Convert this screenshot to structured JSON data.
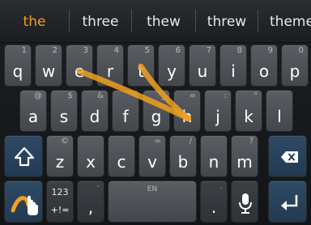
{
  "suggestions": [
    "the",
    "three",
    "thew",
    "threw",
    "theme"
  ],
  "row1": [
    {
      "label": "q",
      "hint": "1"
    },
    {
      "label": "w",
      "hint": "2"
    },
    {
      "label": "e",
      "hint": "3"
    },
    {
      "label": "r",
      "hint": "4"
    },
    {
      "label": "t",
      "hint": "5"
    },
    {
      "label": "y",
      "hint": "6"
    },
    {
      "label": "u",
      "hint": "7"
    },
    {
      "label": "i",
      "hint": "8"
    },
    {
      "label": "o",
      "hint": "9"
    },
    {
      "label": "p",
      "hint": "0"
    }
  ],
  "row2": [
    {
      "label": "a",
      "hint": "@"
    },
    {
      "label": "s",
      "hint": "$"
    },
    {
      "label": "d",
      "hint": "&"
    },
    {
      "label": "f",
      "hint": "-"
    },
    {
      "label": "g",
      "hint": "_"
    },
    {
      "label": "h",
      "hint": "="
    },
    {
      "label": "j",
      "hint": ":"
    },
    {
      "label": "k",
      "hint": "\""
    },
    {
      "label": "l",
      "hint": ""
    }
  ],
  "row3": [
    {
      "label": "z",
      "hint": "©"
    },
    {
      "label": "x",
      "hint": ""
    },
    {
      "label": "c",
      "hint": ""
    },
    {
      "label": "v",
      "hint": "="
    },
    {
      "label": "b",
      "hint": "/"
    },
    {
      "label": "n",
      "hint": ""
    },
    {
      "label": "m",
      "hint": "?"
    }
  ],
  "bottom": {
    "symbols_top": "123",
    "symbols_bottom": "+!=",
    "comma": ",",
    "space_hint": "EN",
    "period": "."
  },
  "colors": {
    "accent": "#f0a020",
    "trail": "#f0a020",
    "func_key": "#2e4a66"
  },
  "icons": {
    "shift": "shift-icon",
    "backspace": "backspace-icon",
    "swype": "swype-icon",
    "mic": "microphone-icon",
    "enter": "enter-icon"
  }
}
